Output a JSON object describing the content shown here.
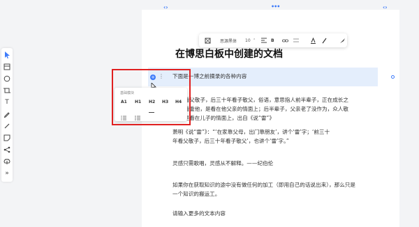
{
  "canvas": {
    "handles": {
      "left": "‹›",
      "center": "•••",
      "right": "‹›"
    }
  },
  "left_toolbar": {
    "tools": [
      {
        "icon": "pointer-icon"
      },
      {
        "icon": "frame-icon"
      },
      {
        "icon": "circle-icon"
      },
      {
        "icon": "crop-icon"
      },
      {
        "icon": "text-tool-icon",
        "glyph": "T"
      },
      {
        "icon": "pen-icon"
      },
      {
        "icon": "line-icon"
      },
      {
        "icon": "sticky-note-icon"
      },
      {
        "icon": "mindmap-icon"
      },
      {
        "icon": "upload-icon"
      },
      {
        "icon": "more-icon",
        "glyph": "»"
      }
    ]
  },
  "format_toolbar": {
    "font_name": "思源黑体",
    "font_size": "10",
    "bold": "B"
  },
  "document": {
    "title": "在博思白板中创建的文档",
    "highlight_line": "下面是一博之前摘录的各种内容",
    "para1": [
      "丰看父敬子，后三十年看子敬父，俗语，意思指人前半辈子，正在成长之",
      "人看重他，是看在他父亲的情面上；后半辈子，父亲老了没作为，众人敬",
      "，是看在儿子的情面上，出自《说“雷”》"
    ],
    "para2": [
      "萧明《说“雷”》：“‘在家靠父母，出门靠朋友’，讲个‘雷’字；‘前三十",
      "年看父敬子，后三十年看子敬父’，也讲个‘雷’字。”"
    ],
    "para3": "灵感只需歌唱，灵感从不解释。——纪伯伦",
    "para4": [
      "如果你在获取知识的途中没有做任何的加工（即用自己的话说出来），那么只是",
      "一个知识的搬运工。"
    ],
    "para5": "请输入更多的文本内容"
  },
  "block_popup": {
    "label": "基础模块",
    "headings": [
      "A1",
      "H1",
      "H2",
      "H3",
      "H4"
    ]
  },
  "colors": {
    "accent": "#3d7bfa",
    "highlight": "#e4eefc",
    "red_frame": "#e02020"
  }
}
